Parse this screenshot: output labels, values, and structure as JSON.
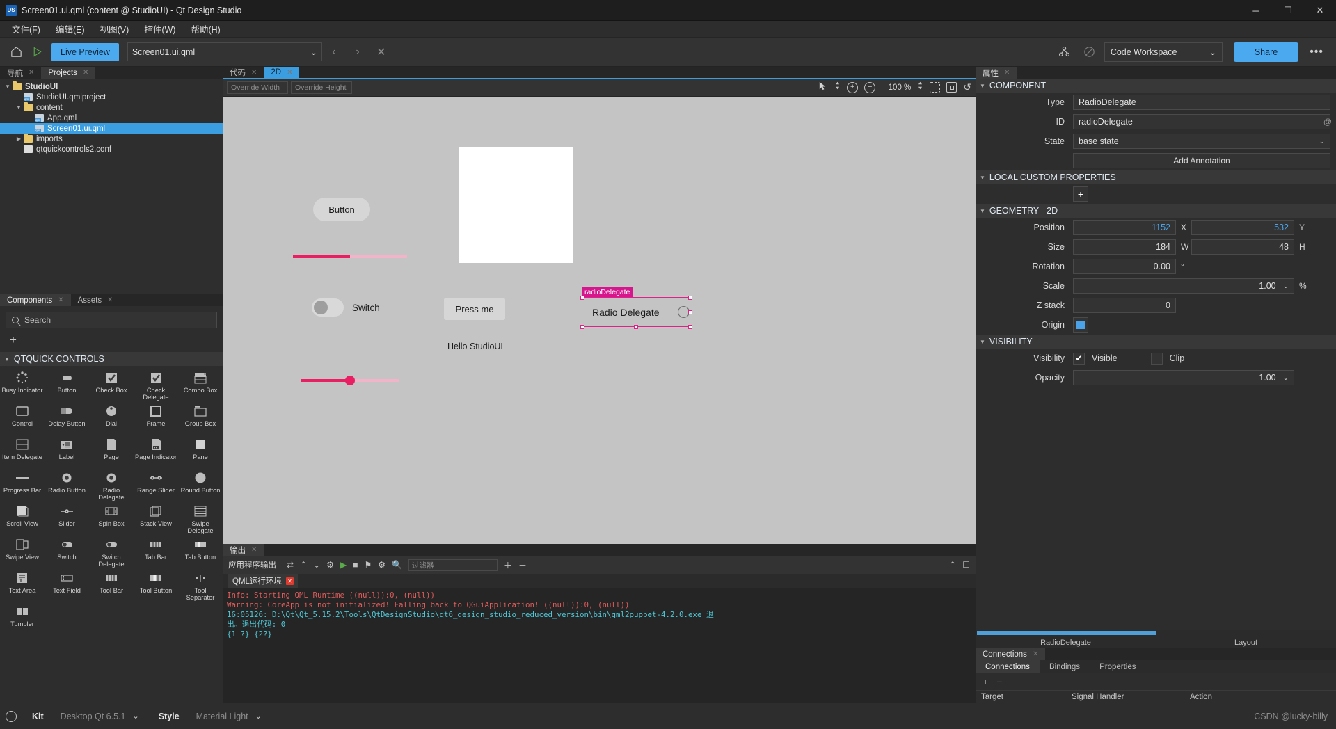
{
  "window": {
    "title": "Screen01.ui.qml (content @ StudioUI) - Qt Design Studio",
    "app_badge": "DS",
    "minimize": "─",
    "maximize": "☐",
    "close": "✕"
  },
  "menubar": {
    "items": [
      {
        "label": "文件(F)"
      },
      {
        "label": "编辑(E)"
      },
      {
        "label": "视图(V)"
      },
      {
        "label": "控件(W)"
      },
      {
        "label": "帮助(H)"
      }
    ]
  },
  "toolbar": {
    "home_icon": "home-icon",
    "run_icon": "play-icon",
    "live_preview": "Live Preview",
    "file_value": "Screen01.ui.qml",
    "chevron": "⌄",
    "back": "‹",
    "forward": "›",
    "close": "✕",
    "nodes_icon": "nodes-icon",
    "disabled_icon": "no-entry-icon",
    "workspace_value": "Code Workspace",
    "share_label": "Share",
    "more_label": "•••"
  },
  "left_panel": {
    "project_tabs": [
      {
        "label": "导航",
        "active": false,
        "closable": true
      },
      {
        "label": "Projects",
        "active": true,
        "closable": true
      }
    ],
    "tree": [
      {
        "label": "StudioUI",
        "indent": 0,
        "twisty": "▼",
        "icon": "qml-folder-icon",
        "selected": false,
        "bold": true
      },
      {
        "label": "StudioUI.qmlproject",
        "indent": 1,
        "twisty": "",
        "icon": "qmlproject-file-icon",
        "selected": false,
        "bold": false
      },
      {
        "label": "content",
        "indent": 1,
        "twisty": "▼",
        "icon": "folder-icon",
        "selected": false,
        "bold": false
      },
      {
        "label": "App.qml",
        "indent": 2,
        "twisty": "",
        "icon": "qml-file-icon",
        "selected": false,
        "bold": false
      },
      {
        "label": "Screen01.ui.qml",
        "indent": 2,
        "twisty": "",
        "icon": "qml-file-icon",
        "selected": true,
        "bold": false
      },
      {
        "label": "imports",
        "indent": 1,
        "twisty": "▶",
        "icon": "folder-icon",
        "selected": false,
        "bold": false
      },
      {
        "label": "qtquickcontrols2.conf",
        "indent": 1,
        "twisty": "",
        "icon": "conf-file-icon",
        "selected": false,
        "bold": false
      }
    ],
    "component_tabs": [
      {
        "label": "Components",
        "active": true,
        "closable": true
      },
      {
        "label": "Assets",
        "active": false,
        "closable": true
      }
    ],
    "search_placeholder": "Search",
    "add_label": "+",
    "section_title": "QTQUICK CONTROLS",
    "section_twisty": "▼",
    "components": [
      {
        "label": "Busy Indicator",
        "icon": "busy-indicator-icon"
      },
      {
        "label": "Button",
        "icon": "button-icon"
      },
      {
        "label": "Check Box",
        "icon": "check-box-icon"
      },
      {
        "label": "Check Delegate",
        "icon": "check-delegate-icon"
      },
      {
        "label": "Combo Box",
        "icon": "combo-box-icon"
      },
      {
        "label": "Control",
        "icon": "control-icon"
      },
      {
        "label": "Delay Button",
        "icon": "delay-button-icon"
      },
      {
        "label": "Dial",
        "icon": "dial-icon"
      },
      {
        "label": "Frame",
        "icon": "frame-icon"
      },
      {
        "label": "Group Box",
        "icon": "group-box-icon"
      },
      {
        "label": "Item Delegate",
        "icon": "item-delegate-icon"
      },
      {
        "label": "Label",
        "icon": "label-icon"
      },
      {
        "label": "Page",
        "icon": "page-icon"
      },
      {
        "label": "Page Indicator",
        "icon": "page-indicator-icon"
      },
      {
        "label": "Pane",
        "icon": "pane-icon"
      },
      {
        "label": "Progress Bar",
        "icon": "progress-bar-icon"
      },
      {
        "label": "Radio Button",
        "icon": "radio-button-icon"
      },
      {
        "label": "Radio Delegate",
        "icon": "radio-delegate-icon"
      },
      {
        "label": "Range Slider",
        "icon": "range-slider-icon"
      },
      {
        "label": "Round Button",
        "icon": "round-button-icon"
      },
      {
        "label": "Scroll View",
        "icon": "scroll-view-icon"
      },
      {
        "label": "Slider",
        "icon": "slider-icon"
      },
      {
        "label": "Spin Box",
        "icon": "spin-box-icon"
      },
      {
        "label": "Stack View",
        "icon": "stack-view-icon"
      },
      {
        "label": "Swipe Delegate",
        "icon": "swipe-delegate-icon"
      },
      {
        "label": "Swipe View",
        "icon": "swipe-view-icon"
      },
      {
        "label": "Switch",
        "icon": "switch-icon"
      },
      {
        "label": "Switch Delegate",
        "icon": "switch-delegate-icon"
      },
      {
        "label": "Tab Bar",
        "icon": "tab-bar-icon"
      },
      {
        "label": "Tab Button",
        "icon": "tab-button-icon"
      },
      {
        "label": "Text Area",
        "icon": "text-area-icon"
      },
      {
        "label": "Text Field",
        "icon": "text-field-icon"
      },
      {
        "label": "Tool Bar",
        "icon": "tool-bar-icon"
      },
      {
        "label": "Tool Button",
        "icon": "tool-button-icon"
      },
      {
        "label": "Tool Separator",
        "icon": "tool-separator-icon"
      },
      {
        "label": "Tumbler",
        "icon": "tumbler-icon"
      }
    ]
  },
  "center_panel": {
    "tabs": [
      {
        "label": "代码",
        "active": false,
        "closable": true
      },
      {
        "label": "2D",
        "active": true,
        "closable": true
      }
    ],
    "override_width_placeholder": "Override Width",
    "override_height_placeholder": "Override Height",
    "zoom_level": "100 %",
    "zoom_in": "+",
    "zoom_out": "−",
    "reset_icon": "↺",
    "canvas": {
      "button_label": "Button",
      "switch_label": "Switch",
      "press_me_label": "Press me",
      "hello_label": "Hello StudioUI",
      "radio_delegate_label": "Radio Delegate",
      "selection_tag": "radioDelegate"
    }
  },
  "output_panel": {
    "tabs": [
      {
        "label": "输出",
        "active": true,
        "closable": true
      }
    ],
    "title": "应用程序输出",
    "filter_placeholder": "过滤器",
    "runtime_tab": "QML运行环境",
    "runtime_close": "✕",
    "lines": [
      {
        "text": "Info: Starting QML Runtime ((null)):0, (null))",
        "color": "red"
      },
      {
        "text": "Warning: CoreApp is not initialized! Falling back to QGuiApplication! ((null)):0, (null))",
        "color": "red"
      },
      {
        "text": "16:05126: D:\\Qt\\Qt_5.15.2\\Tools\\QtDesignStudio\\qt6_design_studio_reduced_version\\bin\\qml2puppet-4.2.0.exe 退",
        "color": "cyan"
      },
      {
        "text": "出。退出代码: 0",
        "color": "cyan"
      },
      {
        "text": "{1 ?} {2?}",
        "color": "cyan"
      }
    ]
  },
  "right_panel": {
    "tabs": [
      {
        "label": "属性",
        "active": true,
        "closable": true
      }
    ],
    "sections": {
      "component": {
        "title": "COMPONENT",
        "twisty": "▼",
        "type_label": "Type",
        "type_value": "RadioDelegate",
        "id_label": "ID",
        "id_value": "radioDelegate",
        "state_label": "State",
        "state_value": "base state",
        "state_chevron": "⌄",
        "annotation_label": "Add Annotation",
        "at_symbol": "@"
      },
      "local_custom_properties": {
        "title": "LOCAL CUSTOM PROPERTIES",
        "twisty": "▼",
        "add_label": "+"
      },
      "geometry": {
        "title": "GEOMETRY - 2D",
        "twisty": "▼",
        "position_label": "Position",
        "position_x": "1152",
        "position_x_unit": "X",
        "position_y": "532",
        "position_y_unit": "Y",
        "size_label": "Size",
        "size_w": "184",
        "size_w_unit": "W",
        "size_h": "48",
        "size_h_unit": "H",
        "rotation_label": "Rotation",
        "rotation_value": "0.00",
        "rotation_unit": "°",
        "scale_label": "Scale",
        "scale_value": "1.00",
        "scale_unit": "%",
        "scale_chevron": "⌄",
        "zstack_label": "Z stack",
        "zstack_value": "0",
        "origin_label": "Origin"
      },
      "visibility": {
        "title": "VISIBILITY",
        "twisty": "▼",
        "visibility_label": "Visibility",
        "visible_text": "Visible",
        "visible_check": "✔",
        "clip_text": "Clip",
        "opacity_label": "Opacity",
        "opacity_value": "1.00",
        "opacity_chevron": "⌄"
      }
    },
    "subpanel_titles": {
      "left": "RadioDelegate",
      "right": "Layout"
    },
    "connections": {
      "outer_tab": "Connections",
      "tabs": [
        {
          "label": "Connections",
          "active": true
        },
        {
          "label": "Bindings",
          "active": false
        },
        {
          "label": "Properties",
          "active": false
        }
      ],
      "add": "+",
      "remove": "−",
      "columns": [
        "Target",
        "Signal Handler",
        "Action"
      ]
    }
  },
  "statusbar": {
    "gear_icon": "gear-icon",
    "kit_label": "Kit",
    "kit_value": "Desktop Qt 6.5.1",
    "kit_chevron": "⌄",
    "style_label": "Style",
    "style_value": "Material Light",
    "style_chevron": "⌄",
    "watermark": "CSDN @lucky-billy"
  }
}
